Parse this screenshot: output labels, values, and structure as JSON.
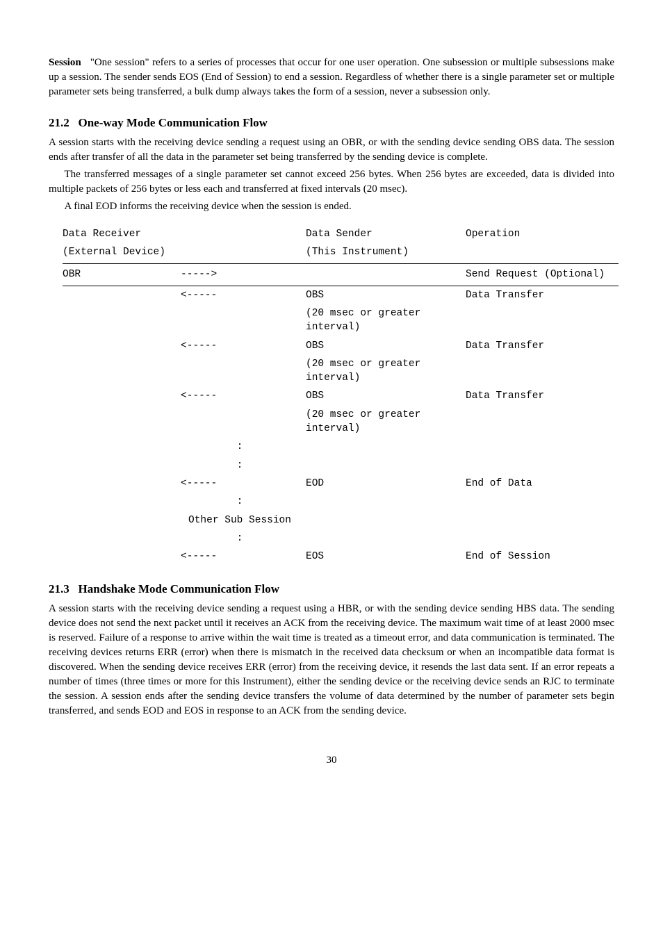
{
  "session": {
    "runin": "Session",
    "text": "   \"One session\" refers to a series of processes that occur for one user operation. One subsession or multiple subsessions make up a session. The sender sends EOS (End of Session) to end a session. Regardless of whether there is a single parameter set or multiple parameter sets being transferred, a bulk dump always takes the form of a session, never a subsession only."
  },
  "sec212": {
    "heading": "21.2   One-way Mode Communication Flow",
    "p1": "A session starts with the receiving device sending a request using an OBR, or with the sending device sending OBS data. The session ends after transfer of all the data in the parameter set being transferred by the sending device is complete.",
    "p2": "The transferred messages of a single parameter set cannot exceed 256 bytes. When 256 bytes are exceeded, data is divided into multiple packets of 256 bytes or less each and transferred at fixed intervals (20 msec).",
    "p3": "A final EOD informs the receiving device when the session is ended."
  },
  "table": {
    "h1": "Data Receiver",
    "h1b": "(External Device)",
    "h2": "Data Sender",
    "h2b": "(This Instrument)",
    "h3": "Operation",
    "rows": {
      "obr": {
        "recv": "OBR",
        "arrow": "----->",
        "sender": "",
        "op": "Send Request (Optional)"
      },
      "r1": {
        "recv": "",
        "arrow": "<-----",
        "sender": "OBS",
        "op": "Data Transfer"
      },
      "r1b": {
        "sender": "(20 msec or greater interval)"
      },
      "r2": {
        "recv": "",
        "arrow": "<-----",
        "sender": "OBS",
        "op": "Data Transfer"
      },
      "r2b": {
        "sender": "(20 msec or greater interval)"
      },
      "r3": {
        "recv": "",
        "arrow": "<-----",
        "sender": "OBS",
        "op": "Data Transfer"
      },
      "r3b": {
        "sender": "(20 msec or greater interval)"
      },
      "d1": {
        "arrow": ":"
      },
      "d2": {
        "arrow": ":"
      },
      "eod": {
        "recv": "",
        "arrow": "<-----",
        "sender": "EOD",
        "op": "End of Data"
      },
      "d3": {
        "arrow": ":"
      },
      "oss": {
        "arrow": "Other Sub Session"
      },
      "d4": {
        "arrow": ":"
      },
      "eos": {
        "recv": "",
        "arrow": "<-----",
        "sender": "EOS",
        "op": "End of Session"
      }
    }
  },
  "sec213": {
    "heading": "21.3   Handshake Mode Communication Flow",
    "p1": "A session starts with the receiving device sending a request using a HBR, or with the sending device sending HBS data. The sending device does not send the next packet until it receives an ACK from the receiving device. The maximum wait time of at least 2000 msec is reserved. Failure of a response to arrive within the wait time is treated as a timeout error, and data communication is terminated. The receiving devices returns ERR (error) when there is mismatch in the received data checksum or when an incompatible data format is discovered. When the sending device receives ERR (error) from the receiving device, it resends the last data sent. If an error repeats a number of times (three times or more for this Instrument), either the sending device or the receiving device sends an RJC to terminate the session. A session ends after the sending device transfers the volume of data determined by the number of parameter sets begin transferred, and sends EOD and EOS in response to an ACK from the sending device."
  },
  "pagenum": "30"
}
